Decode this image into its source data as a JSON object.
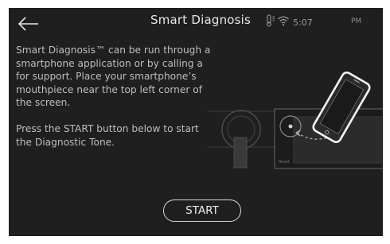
{
  "header": {
    "title": "Smart Diagnosis",
    "time": "5:07",
    "ampm": "PM",
    "icons": {
      "back": "back-arrow-icon",
      "temp": "thermometer-icon",
      "wifi": "wifi-icon"
    }
  },
  "instructions": {
    "p1": "Smart Diagnosis™ can be run through a smartphone application or by calling a for support. Place your smartphone’s mouthpiece near the top left corner of the screen.",
    "p2": "Press the START button below to start the Diagnostic Tone."
  },
  "start_button": {
    "label": "START"
  },
  "illustration": {
    "icon": "smartphone-on-appliance-illustration",
    "small_label": "Reset"
  },
  "colors": {
    "background": "#201f1f",
    "text": "#bdbdbd",
    "title": "#e6e6e6"
  }
}
